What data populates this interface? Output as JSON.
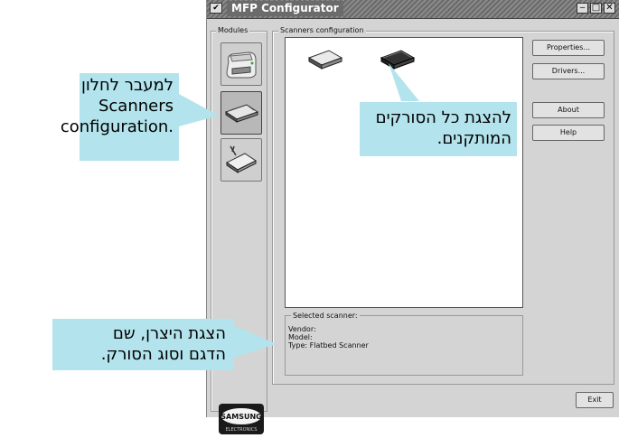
{
  "window": {
    "title": "MFP Configurator",
    "menu_glyph": "✔",
    "minimize_glyph": "‒",
    "maximize_glyph": "□",
    "close_glyph": "✕"
  },
  "modules": {
    "legend": "Modules",
    "items": [
      "printer",
      "scanner",
      "photo-card"
    ],
    "selected": "scanner"
  },
  "scanners": {
    "legend": "Scanners configuration",
    "devices": [
      "flatbed-scanner",
      "flatbed-scanner-selected"
    ]
  },
  "buttons": {
    "properties": "Properties...",
    "drivers": "Drivers...",
    "about": "About",
    "help": "Help",
    "exit": "Exit"
  },
  "selected_scanner": {
    "legend": "Selected scanner:",
    "vendor": "Vendor:",
    "model": "Model:",
    "type": "Type: Flatbed Scanner"
  },
  "logo": {
    "brand": "SAMSUNG",
    "sub": "ELECTRONICS"
  },
  "callouts": {
    "left_top": [
      "למעבר לחלון",
      "Scanners",
      ".configuration"
    ],
    "center": [
      "להצגת כל הסורקים",
      "המותקנים."
    ],
    "bottom": [
      "הצגת היצרן, שם",
      "הדגם וסוג הסורק."
    ]
  },
  "colors": {
    "callout_bg": "#b3e3ec",
    "window_bg": "#d4d4d4"
  }
}
